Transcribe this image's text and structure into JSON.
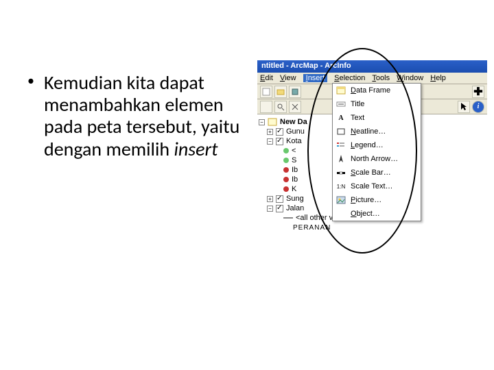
{
  "bullet": {
    "text_pre": "Kemudian kita dapat menambahkan elemen pada peta tersebut, yaitu dengan memilih ",
    "text_em": "insert"
  },
  "app": {
    "title": "ntitled - ArcMap - ArcInfo",
    "menus": {
      "edit": "Edit",
      "view": "View",
      "insert": "Insert",
      "selection": "Selection",
      "tools": "Tools",
      "window": "Window",
      "help": "Help"
    }
  },
  "insertMenu": {
    "data_frame": "Data Frame",
    "title": "Title",
    "text": "Text",
    "neatline": "Neatline…",
    "legend": "Legend…",
    "north_arrow": "North Arrow…",
    "scale_bar": "Scale Bar…",
    "scale_text": "Scale Text…",
    "picture": "Picture…",
    "object": "Object…"
  },
  "toc": {
    "new_da": "New Da",
    "gunu": "Gunu",
    "kota": "Kota",
    "lt": "<",
    "s": "S",
    "ib1": "Ib",
    "ib2": "Ib",
    "k": "K",
    "sung": "Sung",
    "jalan": "Jalan",
    "allother": "<all other values>",
    "footer": "PERANAN"
  }
}
